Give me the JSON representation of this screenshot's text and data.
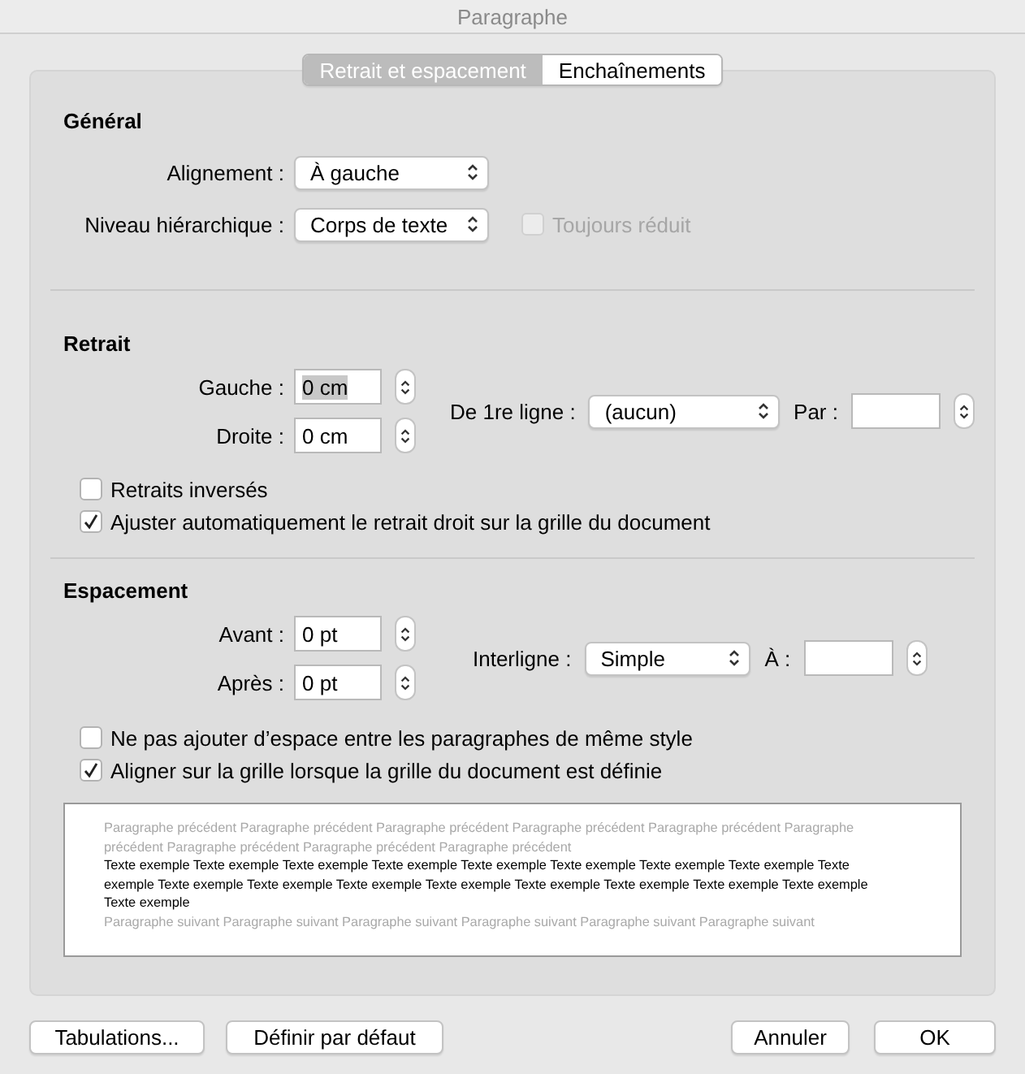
{
  "window": {
    "title": "Paragraphe"
  },
  "tabs": [
    {
      "label": "Retrait et espacement",
      "selected": true
    },
    {
      "label": "Enchaînements",
      "selected": false
    }
  ],
  "general": {
    "heading": "Général",
    "alignment": {
      "label": "Alignement :",
      "value": "À gauche"
    },
    "outline_level": {
      "label": "Niveau hiérarchique :",
      "value": "Corps de texte"
    },
    "collapsed": {
      "label": "Toujours réduit",
      "checked": false,
      "disabled": true
    }
  },
  "indentation": {
    "heading": "Retrait",
    "left": {
      "label": "Gauche :",
      "value": "0 cm",
      "focused": true
    },
    "right": {
      "label": "Droite :",
      "value": "0 cm",
      "focused": false
    },
    "special": {
      "label": "De 1re ligne :",
      "value": "(aucun)"
    },
    "by": {
      "label": "Par :"
    },
    "mirror": {
      "label": "Retraits inversés",
      "checked": false,
      "disabled": false
    },
    "auto_adjust": {
      "label": "Ajuster automatiquement le retrait droit sur la grille du document",
      "checked": true,
      "disabled": false
    }
  },
  "spacing": {
    "heading": "Espacement",
    "before": {
      "label": "Avant :",
      "value": "0 pt",
      "focused": false
    },
    "after": {
      "label": "Après :",
      "value": "0 pt",
      "focused": false
    },
    "line_spacing": {
      "label": "Interligne :",
      "value": "Simple"
    },
    "at": {
      "label": "À :"
    },
    "no_space": {
      "label": "Ne pas ajouter d’espace entre les paragraphes de même style",
      "checked": false,
      "disabled": false
    },
    "snap": {
      "label": "Aligner sur la grille lorsque la grille du document est définie",
      "checked": true,
      "disabled": false
    }
  },
  "preview": {
    "previous": "Paragraphe précédent Paragraphe précédent Paragraphe précédent Paragraphe précédent Paragraphe précédent Paragraphe précédent Paragraphe précédent Paragraphe précédent Paragraphe précédent",
    "sample": "Texte exemple Texte exemple Texte exemple Texte exemple Texte exemple Texte exemple Texte exemple Texte exemple Texte exemple Texte exemple Texte exemple Texte exemple Texte exemple Texte exemple Texte exemple Texte exemple Texte exemple Texte exemple",
    "next": "Paragraphe suivant Paragraphe suivant Paragraphe suivant Paragraphe suivant Paragraphe suivant Paragraphe suivant"
  },
  "buttons": [
    "Tabulations...",
    "Définir par défaut",
    "Annuler",
    "OK"
  ]
}
